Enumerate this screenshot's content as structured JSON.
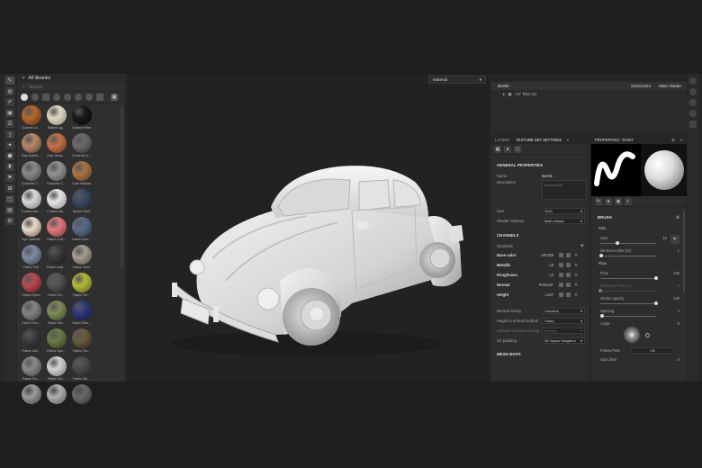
{
  "shelf": {
    "header": "All libraries",
    "search_placeholder": "Search",
    "materials": [
      {
        "label": "Autumn Le...",
        "color": "#b5652d",
        "shade": "#5e2f10"
      },
      {
        "label": "Baked Lig...",
        "color": "#e0d7c4",
        "shade": "#8d8576"
      },
      {
        "label": "Carbon Fiber",
        "color": "#1a1a1a",
        "shade": "#050505"
      },
      {
        "label": "",
        "color": "#2f2f2f",
        "shade": "#2f2f2f"
      },
      {
        "label": "Clay Earthe...",
        "color": "#b8896b",
        "shade": "#5e3d2a"
      },
      {
        "label": "Clay Terrac...",
        "color": "#c4714a",
        "shade": "#6a3419"
      },
      {
        "label": "Concrete A...",
        "color": "#6b6b6b",
        "shade": "#303030"
      },
      {
        "label": "",
        "color": "#2f2f2f",
        "shade": "#2f2f2f"
      },
      {
        "label": "Concrete C...",
        "color": "#8a8a8a",
        "shade": "#404040"
      },
      {
        "label": "Concrete C...",
        "color": "#939393",
        "shade": "#474747"
      },
      {
        "label": "Cork Natural",
        "color": "#a87447",
        "shade": "#5a3a1e"
      },
      {
        "label": "",
        "color": "#2f2f2f",
        "shade": "#2f2f2f"
      },
      {
        "label": "Custom Ba...",
        "color": "#d8d8d8",
        "shade": "#777777"
      },
      {
        "label": "Custom Ba...",
        "color": "#e6e6e6",
        "shade": "#888888"
      },
      {
        "label": "Denim Rivet",
        "color": "#3b4a66",
        "shade": "#1a2233"
      },
      {
        "label": "",
        "color": "#2f2f2f",
        "shade": "#2f2f2f"
      },
      {
        "label": "Eye material",
        "color": "#e8dccb",
        "shade": "#6f5a46"
      },
      {
        "label": "Fabric Cott...",
        "color": "#e07a7a",
        "shade": "#7a3535"
      },
      {
        "label": "Fabric Den...",
        "color": "#5a6a8a",
        "shade": "#283448"
      },
      {
        "label": "",
        "color": "#2f2f2f",
        "shade": "#2f2f2f"
      },
      {
        "label": "Fabric Felt",
        "color": "#7c8aa0",
        "shade": "#3a4354"
      },
      {
        "label": "Fabric Leat...",
        "color": "#3a3a3a",
        "shade": "#181818"
      },
      {
        "label": "Fabric Linen",
        "color": "#a59c90",
        "shade": "#514b43"
      },
      {
        "label": "",
        "color": "#2f2f2f",
        "shade": "#2f2f2f"
      },
      {
        "label": "Fabric Nylon",
        "color": "#b84b52",
        "shade": "#5a1e22"
      },
      {
        "label": "Fabric Pol...",
        "color": "#555555",
        "shade": "#232323"
      },
      {
        "label": "Fabric Pol...",
        "color": "#b5b83a",
        "shade": "#5a5c14"
      },
      {
        "label": "",
        "color": "#2f2f2f",
        "shade": "#2f2f2f"
      },
      {
        "label": "Fabric Rou...",
        "color": "#848484",
        "shade": "#3c3c3c"
      },
      {
        "label": "Fabric Sta...",
        "color": "#7f8b55",
        "shade": "#3c4424"
      },
      {
        "label": "Fabric Plas...",
        "color": "#2d3a7a",
        "shade": "#121a40"
      },
      {
        "label": "",
        "color": "#2f2f2f",
        "shade": "#2f2f2f"
      },
      {
        "label": "Fabric Swi...",
        "color": "#3c3c3c",
        "shade": "#1a1a1a"
      },
      {
        "label": "Fabric Spo...",
        "color": "#6a7b46",
        "shade": "#313a1e"
      },
      {
        "label": "Fabric Tex...",
        "color": "#6a5a40",
        "shade": "#30281a"
      },
      {
        "label": "",
        "color": "#2f2f2f",
        "shade": "#2f2f2f"
      },
      {
        "label": "Fabric Tex...",
        "color": "#8a8a8a",
        "shade": "#3f3f3f"
      },
      {
        "label": "Fabric Tex...",
        "color": "#d4d4d4",
        "shade": "#6f6f6f"
      },
      {
        "label": "Fabric Vel...",
        "color": "#4a4a4a",
        "shade": "#202020"
      },
      {
        "label": "",
        "color": "#2f2f2f",
        "shade": "#2f2f2f"
      },
      {
        "label": "",
        "color": "#9a9a9a",
        "shade": "#444444"
      },
      {
        "label": "",
        "color": "#b0b0b0",
        "shade": "#555555"
      },
      {
        "label": "",
        "color": "#6a6a6a",
        "shade": "#303030"
      },
      {
        "label": "",
        "color": "#2f2f2f",
        "shade": "#2f2f2f"
      }
    ]
  },
  "viewport": {
    "mode_select": "Material"
  },
  "stack": {
    "asset_name": "Beetle",
    "resolution": "1024x1024",
    "shader": "Main shader",
    "sub_item": "UV Tiles (4)"
  },
  "tss": {
    "tab_layers": "LAYERS",
    "tab_tss": "TEXTURE SET SETTINGS",
    "general_title": "GENERAL PROPERTIES",
    "name_label": "Name",
    "name_value": "Beetle",
    "description_label": "Description",
    "description_placeholder": "Description",
    "size_label": "Size",
    "size_value": "1024",
    "shader_label": "Shader instance",
    "shader_value": "Main shader",
    "channels_title": "CHANNELS",
    "channels_label": "Channels",
    "channels": [
      {
        "name": "Base color",
        "format": "sRGB8"
      },
      {
        "name": "Metallic",
        "format": "L8"
      },
      {
        "name": "Roughness",
        "format": "L8"
      },
      {
        "name": "Normal",
        "format": "RGB16F"
      },
      {
        "name": "Height",
        "format": "L16F"
      }
    ],
    "normal_mixing_label": "Normal mixing",
    "normal_mixing_value": "Combine",
    "height_method_label": "Height to normal method",
    "height_method_value": "Sharp",
    "ao_mixing_label": "Ambient occlusion mixing",
    "ao_mixing_value": "Multiply",
    "uv_padding_label": "UV padding",
    "uv_padding_value": "3D Space Neighbor",
    "mesh_maps_title": "MESH MAPS"
  },
  "props": {
    "title": "PROPERTIES - PAINT",
    "brush_title": "BRUSH",
    "size_label": "Size",
    "size_value": "10",
    "size_level": 0.3,
    "min_size_label": "Minimum Size (%)",
    "min_size_value": "1",
    "min_size_level": 0.01,
    "flow_title": "Flow",
    "flow_label": "Flow",
    "flow_value": "100",
    "flow_level": 1.0,
    "min_flow_label": "Minimum Flow (%)",
    "min_flow_value": "0",
    "min_flow_level": 0.0,
    "stroke_label": "Stroke opacity",
    "stroke_value": "100",
    "stroke_level": 1.0,
    "spacing_label": "Spacing",
    "spacing_value": "3",
    "spacing_level": 0.03,
    "angle_label": "Angle",
    "angle_value": "0",
    "follow_label": "Follow Path",
    "follow_value": "Off",
    "jitter_label": "Size Jitter",
    "jitter_value": "0"
  }
}
